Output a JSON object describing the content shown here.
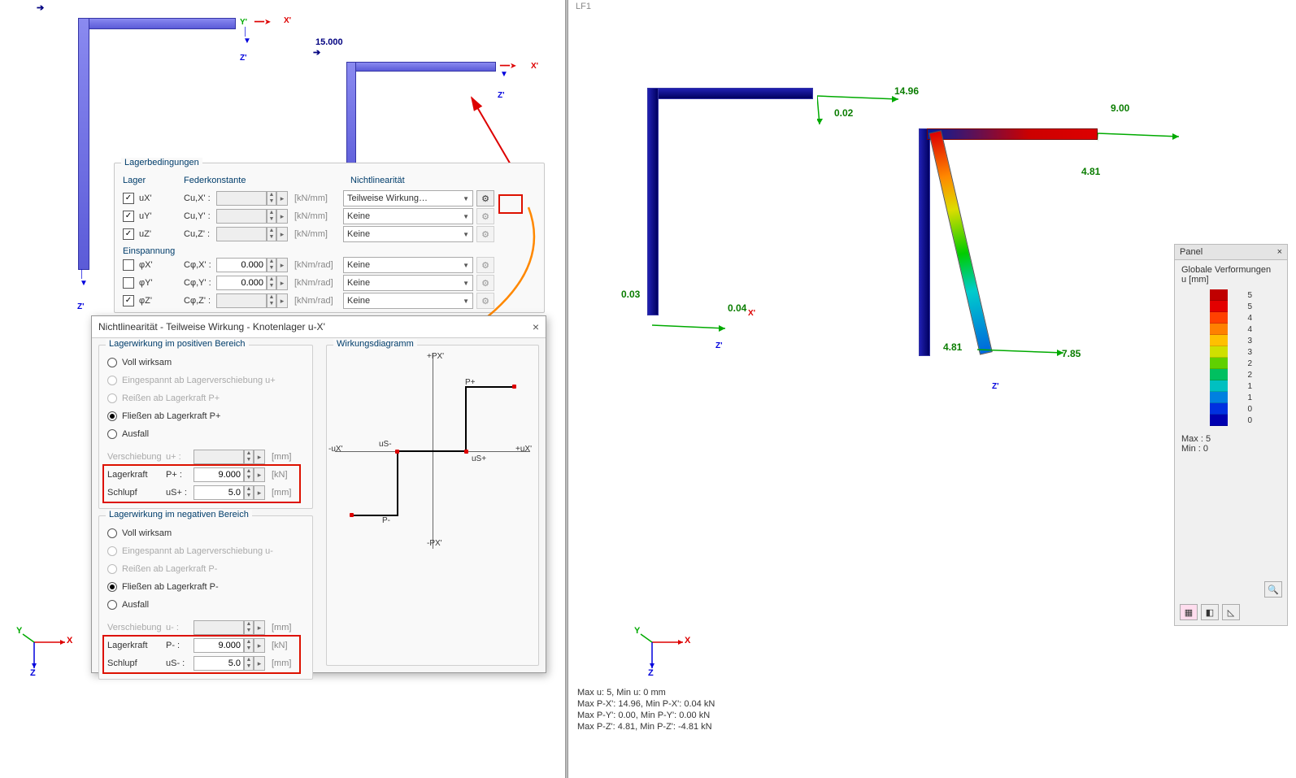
{
  "load_value": "15.000",
  "viewport_right_header": "LF1",
  "lagerbedingungen": {
    "title": "Lagerbedingungen",
    "col_lager": "Lager",
    "col_feder": "Federkonstante",
    "col_nl": "Nichtlinearität",
    "einspannung": "Einspannung",
    "rows_translate": [
      {
        "name": "uX'",
        "spring": "Cu,X' :",
        "unit": "[kN/mm]",
        "nl": "Teilweise Wirkung…"
      },
      {
        "name": "uY'",
        "spring": "Cu,Y' :",
        "unit": "[kN/mm]",
        "nl": "Keine"
      },
      {
        "name": "uZ'",
        "spring": "Cu,Z' :",
        "unit": "[kN/mm]",
        "nl": "Keine"
      }
    ],
    "rows_rotate": [
      {
        "name": "φX'",
        "spring": "Cφ,X' :",
        "val": "0.000",
        "unit": "[kNm/rad]",
        "nl": "Keine",
        "checked": false
      },
      {
        "name": "φY'",
        "spring": "Cφ,Y' :",
        "val": "0.000",
        "unit": "[kNm/rad]",
        "nl": "Keine",
        "checked": false
      },
      {
        "name": "φZ'",
        "spring": "Cφ,Z' :",
        "val": "",
        "unit": "[kNm/rad]",
        "nl": "Keine",
        "checked": true
      }
    ]
  },
  "dialog": {
    "title": "Nichtlinearität - Teilweise Wirkung - Knotenlager u-X'",
    "pos_title": "Lagerwirkung im positiven Bereich",
    "neg_title": "Lagerwirkung im negativen Bereich",
    "diagram_title": "Wirkungsdiagramm",
    "opt_voll": "Voll wirksam",
    "opt_einge_p": "Eingespannt ab Lagerverschiebung u+",
    "opt_reissen_p": "Reißen ab Lagerkraft P+",
    "opt_fliessen_p": "Fließen ab Lagerkraft P+",
    "opt_ausfall": "Ausfall",
    "opt_einge_n": "Eingespannt ab Lagerverschiebung u-",
    "opt_reissen_n": "Reißen ab Lagerkraft P-",
    "opt_fliessen_n": "Fließen ab Lagerkraft P-",
    "verschiebung": "Verschiebung",
    "u_plus": "u+  :",
    "u_minus": "u-  :",
    "lagerkraft": "Lagerkraft",
    "p_plus": "P+  :",
    "p_minus": "P-  :",
    "schlupf": "Schlupf",
    "us_plus": "uS+ :",
    "us_minus": "uS- :",
    "val_force": "9.000",
    "val_slip": "5.0",
    "unit_kn": "[kN]",
    "unit_mm": "[mm]",
    "diag": {
      "px_plus": "+PX'",
      "px_minus": "-PX'",
      "ux_plus": "+uX'",
      "ux_minus": "-uX'",
      "p_plus": "P+",
      "p_minus": "P-",
      "us_plus": "uS+",
      "us_minus": "uS-"
    }
  },
  "results": {
    "left_top": "14.96",
    "left_top2": "0.02",
    "left_bl_x": "0.03",
    "left_bl_z": "0.04",
    "right_top": "9.00",
    "right_top2": "4.81",
    "right_bl_x": "4.81",
    "right_bl_z": "7.85"
  },
  "panel": {
    "title": "Panel",
    "subtitle": "Globale Verformungen",
    "unit": "u [mm]",
    "ticks": [
      "5",
      "5",
      "4",
      "4",
      "3",
      "3",
      "2",
      "2",
      "1",
      "1",
      "0",
      "0"
    ],
    "max_label": "Max :",
    "min_label": "Min  :",
    "max_val": "5",
    "min_val": "0"
  },
  "status": {
    "l1": "Max u: 5, Min u: 0 mm",
    "l2": "Max P-X': 14.96, Min P-X': 0.04 kN",
    "l3": "Max P-Y': 0.00, Min P-Y': 0.00 kN",
    "l4": "Max P-Z': 4.81, Min P-Z': -4.81 kN"
  },
  "axes": {
    "x": "X",
    "y": "Y",
    "z": "Z",
    "xp": "X'",
    "yp": "Y'",
    "zp": "Z'"
  }
}
